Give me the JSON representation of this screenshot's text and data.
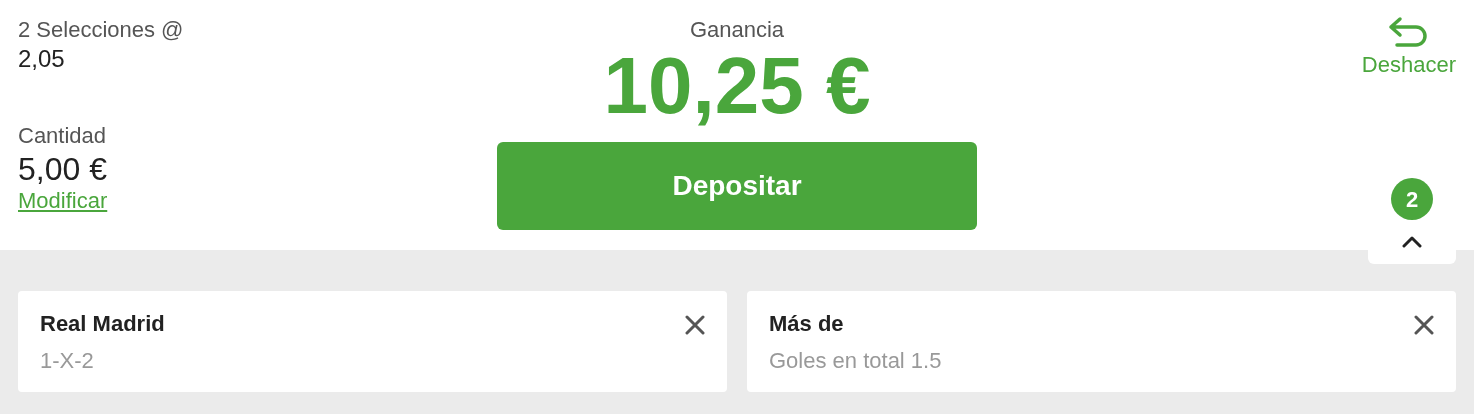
{
  "summary": {
    "selections_label": "2 Selecciones @",
    "odds": "2,05",
    "amount_label": "Cantidad",
    "amount": "5,00 €",
    "modify_link": "Modificar"
  },
  "winnings": {
    "label": "Ganancia",
    "value": "10,25 €"
  },
  "deposit_button": "Depositar",
  "undo_button": "Deshacer",
  "selection_count": "2",
  "selections": [
    {
      "title": "Real Madrid",
      "market": "1-X-2"
    },
    {
      "title": "Más de",
      "market": "Goles en total 1.5"
    }
  ]
}
